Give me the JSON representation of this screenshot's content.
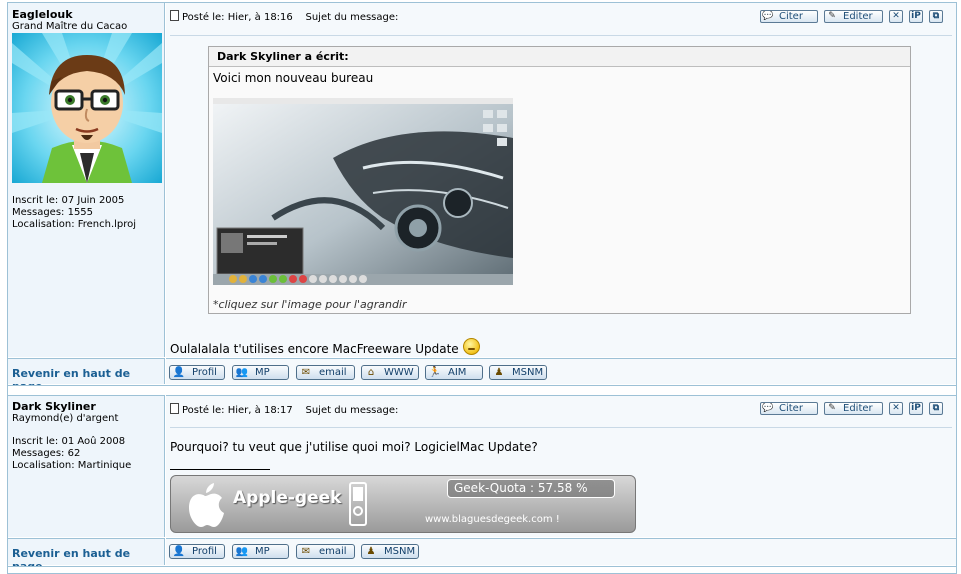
{
  "posts": [
    {
      "author": "Eaglelouk",
      "rank": "Grand Maître du Cacao",
      "joined": "Inscrit le: 07 Juin 2005",
      "messages": "Messages: 1555",
      "location": "Localisation: French.lproj",
      "posted": "Posté le: Hier, à 18:16",
      "subject": "Sujet du message:",
      "quote": {
        "header": "Dark Skyliner a écrit:",
        "text": "Voici mon nouveau bureau",
        "caption": "*cliquez sur l'image pour l'agrandir"
      },
      "body": "Oulalalala t'utilises encore MacFreeware Update",
      "back_to_top": "Revenir en haut de page",
      "profile_buttons": [
        "Profil",
        "MP",
        "email",
        "WWW",
        "AIM",
        "MSNM"
      ]
    },
    {
      "author": "Dark Skyliner",
      "rank": "Raymond(e) d'argent",
      "joined": "Inscrit le: 01 Aoû 2008",
      "messages": "Messages: 62",
      "location": "Localisation: Martinique",
      "posted": "Posté le: Hier, à 18:17",
      "subject": "Sujet du message:",
      "body": "Pourquoi? tu veut que j'utilise quoi moi? LogicielMac Update?",
      "signature": {
        "brand": "Apple-geek",
        "quota": "Geek-Quota : 57.58 %",
        "url": "www.blaguesdegeek.com !"
      },
      "back_to_top": "Revenir en haut de page",
      "profile_buttons": [
        "Profil",
        "MP",
        "email",
        "MSNM"
      ]
    }
  ],
  "action_buttons": {
    "quote": "Citer",
    "edit": "Editer",
    "delete": "✕",
    "ip": "iP",
    "copy": "⧉"
  },
  "colors": {
    "border": "#9dc1d6",
    "link": "#1b5f93",
    "left_bg": "#eef5fb",
    "right_bg": "#f5f9fc"
  }
}
